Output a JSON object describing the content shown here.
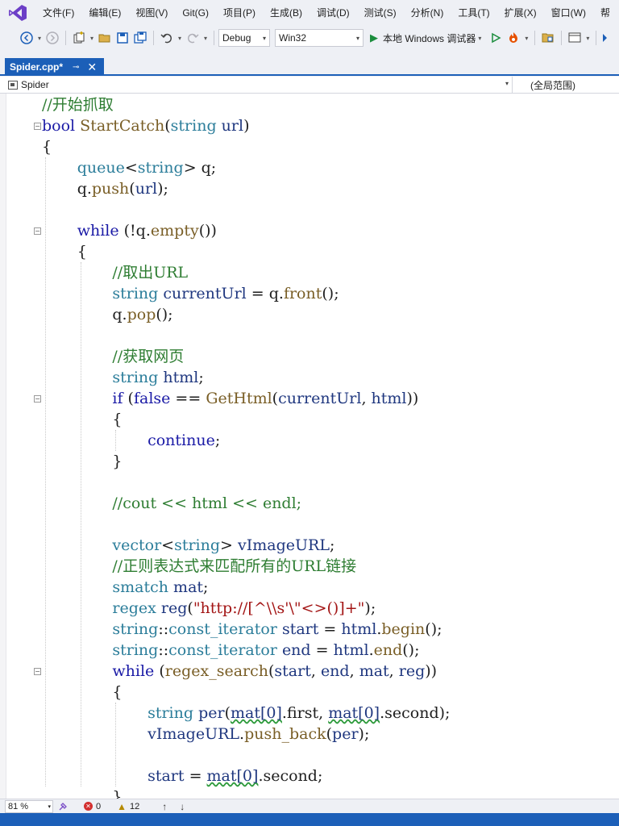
{
  "colors": {
    "accent": "#1c5fb8",
    "comment": "#2e7d32",
    "keyword": "#1a1aa6",
    "type": "#2b7d9a",
    "function": "#795e26",
    "string": "#a31515",
    "error": "#d32f2f",
    "warning": "#b58a00"
  },
  "menu": [
    "文件(F)",
    "编辑(E)",
    "视图(V)",
    "Git(G)",
    "项目(P)",
    "生成(B)",
    "调试(D)",
    "测试(S)",
    "分析(N)",
    "工具(T)",
    "扩展(X)",
    "窗口(W)",
    "帮"
  ],
  "toolbar": {
    "configuration": "Debug",
    "platform": "Win32",
    "run_label": "本地 Windows 调试器",
    "icons": [
      "back-icon",
      "forward-icon",
      "new-project-icon",
      "open-folder-icon",
      "save-icon",
      "save-all-icon",
      "undo-icon",
      "redo-icon",
      "start-without-debug-icon",
      "hot-reload-icon",
      "solution-explorer-icon",
      "layout-icon"
    ]
  },
  "tab": {
    "title": "Spider.cpp*",
    "pin": "⊸",
    "close": "✕"
  },
  "navbar": {
    "scope": "Spider",
    "member": "(全局范围)"
  },
  "code": [
    {
      "indent": 0,
      "tokens": [
        [
          "cm",
          "//开始抓取"
        ]
      ]
    },
    {
      "indent": 0,
      "fold": true,
      "tokens": [
        [
          "kw",
          "bool"
        ],
        [
          "",
          " "
        ],
        [
          "fn",
          "StartCatch"
        ],
        [
          "",
          "("
        ],
        [
          "ty",
          "string"
        ],
        [
          "",
          " "
        ],
        [
          "va",
          "url"
        ],
        [
          "",
          ")"
        ]
      ]
    },
    {
      "indent": 0,
      "tokens": [
        [
          "",
          "{"
        ]
      ]
    },
    {
      "indent": 1,
      "tokens": [
        [
          "ty",
          "queue"
        ],
        [
          "",
          "<"
        ],
        [
          "ty",
          "string"
        ],
        [
          "",
          "> q;"
        ]
      ]
    },
    {
      "indent": 1,
      "tokens": [
        [
          "",
          "q."
        ],
        [
          "fn",
          "push"
        ],
        [
          "",
          "("
        ],
        [
          "va",
          "url"
        ],
        [
          "",
          ");"
        ]
      ]
    },
    {
      "indent": 0,
      "tokens": []
    },
    {
      "indent": 1,
      "fold": true,
      "tokens": [
        [
          "kw",
          "while"
        ],
        [
          "",
          " (!q."
        ],
        [
          "fn",
          "empty"
        ],
        [
          "",
          "())"
        ]
      ]
    },
    {
      "indent": 1,
      "tokens": [
        [
          "",
          "{"
        ]
      ]
    },
    {
      "indent": 2,
      "tokens": [
        [
          "cm",
          "//取出URL"
        ]
      ]
    },
    {
      "indent": 2,
      "tokens": [
        [
          "ty",
          "string"
        ],
        [
          "",
          " "
        ],
        [
          "va",
          "currentUrl"
        ],
        [
          "",
          " = q."
        ],
        [
          "fn",
          "front"
        ],
        [
          "",
          "();"
        ]
      ]
    },
    {
      "indent": 2,
      "tokens": [
        [
          "",
          "q."
        ],
        [
          "fn",
          "pop"
        ],
        [
          "",
          "();"
        ]
      ]
    },
    {
      "indent": 0,
      "tokens": []
    },
    {
      "indent": 2,
      "tokens": [
        [
          "cm",
          "//获取网页"
        ]
      ]
    },
    {
      "indent": 2,
      "tokens": [
        [
          "ty",
          "string"
        ],
        [
          "",
          " "
        ],
        [
          "va",
          "html"
        ],
        [
          "",
          ";"
        ]
      ]
    },
    {
      "indent": 2,
      "fold": true,
      "tokens": [
        [
          "kw",
          "if"
        ],
        [
          "",
          " ("
        ],
        [
          "kw",
          "false"
        ],
        [
          "",
          " == "
        ],
        [
          "fn",
          "GetHtml"
        ],
        [
          "",
          "("
        ],
        [
          "va",
          "currentUrl"
        ],
        [
          "",
          ", "
        ],
        [
          "va",
          "html"
        ],
        [
          "",
          "))"
        ]
      ]
    },
    {
      "indent": 2,
      "tokens": [
        [
          "",
          "{"
        ]
      ]
    },
    {
      "indent": 3,
      "tokens": [
        [
          "kw",
          "continue"
        ],
        [
          "",
          ";"
        ]
      ]
    },
    {
      "indent": 2,
      "tokens": [
        [
          "",
          "}"
        ]
      ]
    },
    {
      "indent": 0,
      "tokens": []
    },
    {
      "indent": 2,
      "tokens": [
        [
          "cm",
          "//cout << html << endl;"
        ]
      ]
    },
    {
      "indent": 0,
      "tokens": []
    },
    {
      "indent": 2,
      "tokens": [
        [
          "ty",
          "vector"
        ],
        [
          "",
          "<"
        ],
        [
          "ty",
          "string"
        ],
        [
          "",
          "> "
        ],
        [
          "va",
          "vImageURL"
        ],
        [
          "",
          ";"
        ]
      ]
    },
    {
      "indent": 2,
      "tokens": [
        [
          "cm",
          "//正则表达式来匹配所有的URL链接"
        ]
      ]
    },
    {
      "indent": 2,
      "tokens": [
        [
          "ty",
          "smatch"
        ],
        [
          "",
          " "
        ],
        [
          "va",
          "mat"
        ],
        [
          "",
          ";"
        ]
      ]
    },
    {
      "indent": 2,
      "tokens": [
        [
          "ty",
          "regex"
        ],
        [
          "",
          " "
        ],
        [
          "va",
          "reg"
        ],
        [
          "",
          "("
        ],
        [
          "st",
          "\"http://[^\\\\s'\\\"<>()]+\""
        ],
        [
          "",
          ");"
        ]
      ]
    },
    {
      "indent": 2,
      "tokens": [
        [
          "ty",
          "string"
        ],
        [
          "",
          "::"
        ],
        [
          "ty",
          "const_iterator"
        ],
        [
          "",
          " "
        ],
        [
          "va",
          "start"
        ],
        [
          "",
          " = "
        ],
        [
          "va",
          "html"
        ],
        [
          "",
          "."
        ],
        [
          "fn",
          "begin"
        ],
        [
          "",
          "();"
        ]
      ]
    },
    {
      "indent": 2,
      "tokens": [
        [
          "ty",
          "string"
        ],
        [
          "",
          "::"
        ],
        [
          "ty",
          "const_iterator"
        ],
        [
          "",
          " "
        ],
        [
          "va",
          "end"
        ],
        [
          "",
          " = "
        ],
        [
          "va",
          "html"
        ],
        [
          "",
          "."
        ],
        [
          "fn",
          "end"
        ],
        [
          "",
          "();"
        ]
      ]
    },
    {
      "indent": 2,
      "fold": true,
      "tokens": [
        [
          "kw",
          "while"
        ],
        [
          "",
          " ("
        ],
        [
          "fn",
          "regex_search"
        ],
        [
          "",
          "("
        ],
        [
          "va",
          "start"
        ],
        [
          "",
          ", "
        ],
        [
          "va",
          "end"
        ],
        [
          "",
          ", "
        ],
        [
          "va",
          "mat"
        ],
        [
          "",
          ", "
        ],
        [
          "va",
          "reg"
        ],
        [
          "",
          "))"
        ]
      ]
    },
    {
      "indent": 2,
      "tokens": [
        [
          "",
          "{"
        ]
      ]
    },
    {
      "indent": 3,
      "tokens": [
        [
          "ty",
          "string"
        ],
        [
          "",
          " "
        ],
        [
          "va",
          "per"
        ],
        [
          "",
          "("
        ],
        [
          "va squiggle",
          "mat[0]"
        ],
        [
          "",
          ".first, "
        ],
        [
          "va squiggle",
          "mat[0]"
        ],
        [
          "",
          ".second);"
        ]
      ]
    },
    {
      "indent": 3,
      "tokens": [
        [
          "va",
          "vImageURL"
        ],
        [
          "",
          "."
        ],
        [
          "fn",
          "push_back"
        ],
        [
          "",
          "("
        ],
        [
          "va",
          "per"
        ],
        [
          "",
          ");"
        ]
      ]
    },
    {
      "indent": 0,
      "tokens": []
    },
    {
      "indent": 3,
      "tokens": [
        [
          "va",
          "start"
        ],
        [
          "",
          " = "
        ],
        [
          "va squiggle",
          "mat[0]"
        ],
        [
          "",
          ".second;"
        ]
      ]
    },
    {
      "indent": 2,
      "tokens": [
        [
          "",
          "}"
        ]
      ]
    }
  ],
  "status": {
    "zoom": "81 %",
    "errors": "0",
    "warnings": "12",
    "up_arrow": "↑",
    "down_arrow": "↓"
  }
}
